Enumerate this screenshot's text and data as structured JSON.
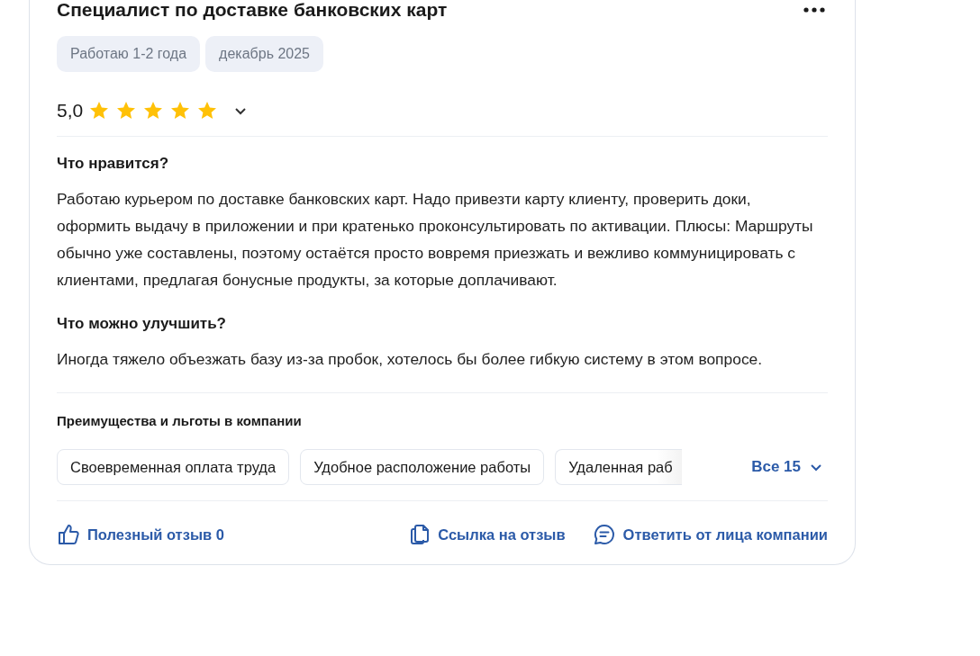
{
  "review": {
    "title": "Специалист по доставке банковских карт",
    "tags": [
      "Работаю 1-2 года",
      "декабрь 2025"
    ],
    "rating": {
      "value": "5,0",
      "stars": 5
    },
    "sections": [
      {
        "heading": "Что нравится?",
        "text": "Работаю курьером по доставке банковских карт. Надо привезти карту клиенту, проверить доки, оформить выдачу в приложении и при кратенько проконсультировать по активации. Плюсы: Маршруты обычно уже составлены, поэтому остаётся просто вовремя приезжать и вежливо коммуницировать с клиентами, предлагая бонусные продукты, за которые доплачивают."
      },
      {
        "heading": "Что можно улучшить?",
        "text": "Иногда тяжело объезжать базу из-за пробок, хотелось бы более гибкую систему в этом вопросе."
      }
    ],
    "benefits": {
      "heading": "Преимущества и льготы в компании",
      "items": [
        "Своевременная оплата труда",
        "Удобное расположение работы",
        "Удаленная раб"
      ],
      "more": "Все 15"
    },
    "actions": [
      {
        "kind": "like",
        "label": "Полезный отзыв 0"
      },
      {
        "kind": "link",
        "label": "Ссылка на отзыв"
      },
      {
        "kind": "reply",
        "label": "Ответить от лица компании"
      }
    ]
  }
}
